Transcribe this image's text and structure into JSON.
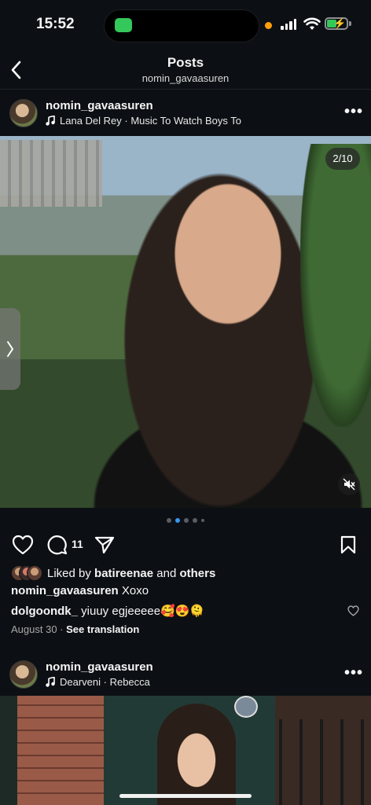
{
  "status_bar": {
    "time": "15:52"
  },
  "header": {
    "title": "Posts",
    "subtitle": "nomin_gavaasuren"
  },
  "post1": {
    "username": "nomin_gavaasuren",
    "music": "Lana Del Rey · Music To Watch Boys To",
    "counter": "2/10",
    "carousel": {
      "total_dots": 5,
      "active_index": 1
    },
    "comment_count": "11",
    "liked_prefix": "Liked by ",
    "liked_user": "batireenae",
    "liked_mid": " and ",
    "liked_others": "others",
    "caption_user": "nomin_gavaasuren",
    "caption_text": " Xoxo",
    "comment_user": "dolgoondk_",
    "comment_text": " yiuuy egjeeeee🥰😍🫠",
    "date": "August 30",
    "date_sep": " · ",
    "translate": "See translation"
  },
  "post2": {
    "username": "nomin_gavaasuren",
    "music": "Dearveni · Rebecca"
  },
  "colors": {
    "accent_blue": "#3897f0",
    "background": "#0c1014",
    "camera_green": "#34c759",
    "mic_orange": "#ff9f0a"
  }
}
